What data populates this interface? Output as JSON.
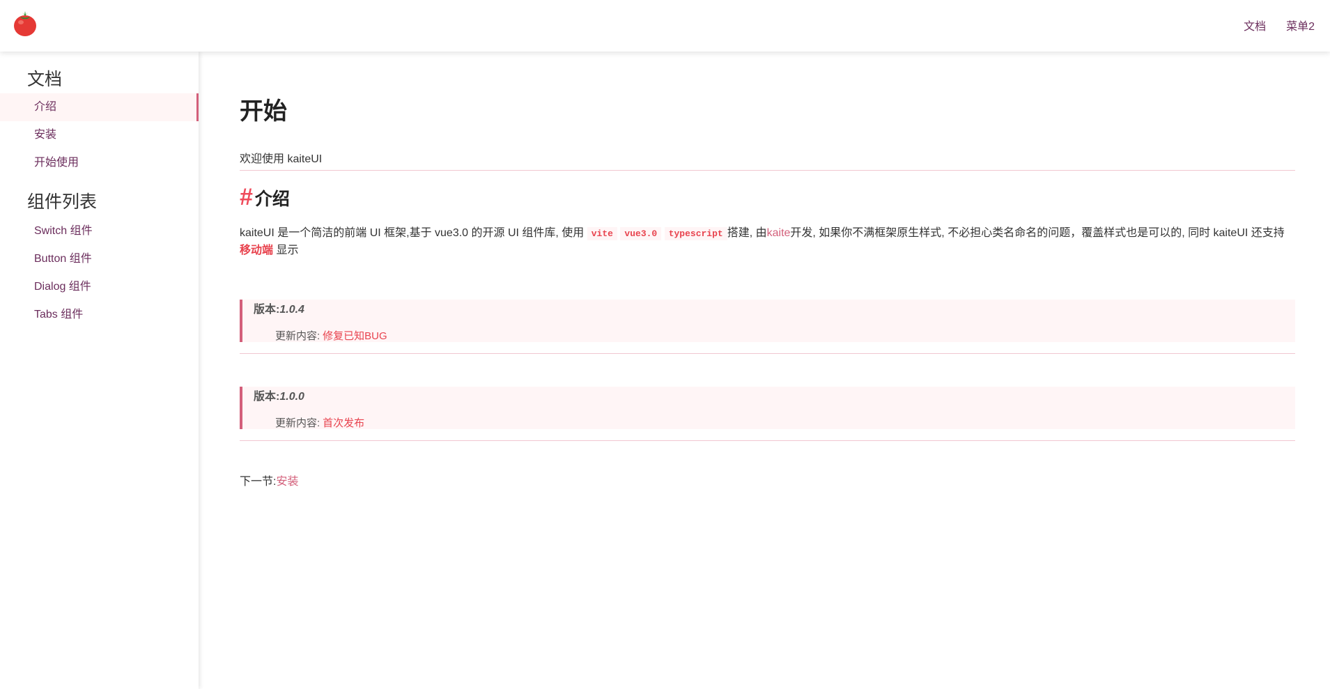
{
  "header": {
    "nav": [
      "文档",
      "菜单2"
    ]
  },
  "sidebar": {
    "groups": [
      {
        "title": "文档",
        "items": [
          "介绍",
          "安装",
          "开始使用"
        ]
      },
      {
        "title": "组件列表",
        "items": [
          "Switch 组件",
          "Button 组件",
          "Dialog 组件",
          "Tabs 组件"
        ]
      }
    ],
    "active_item": "介绍"
  },
  "main": {
    "title": "开始",
    "welcome": "欢迎使用 kaiteUI",
    "section": {
      "hash": "#",
      "title": "介绍"
    },
    "intro": {
      "p1": "kaiteUI 是一个简洁的前端 UI 框架,基于 vue3.0 的开源 UI 组件库, 使用",
      "code1": "vite",
      "code2": "vue3.0",
      "code3": "typescript",
      "p2": "搭建, 由",
      "author": "kaite",
      "p3": "开发, 如果你不满框架原生样式, 不必担心类名命名的问题，覆盖样式也是可以的, 同时 kaiteUI 还支持",
      "mobile": "移动端",
      "p4": "显示"
    },
    "versions": [
      {
        "label": "版本:",
        "number": "1.0.4",
        "update_label": "更新内容:",
        "update_value": "修复已知BUG"
      },
      {
        "label": "版本:",
        "number": "1.0.0",
        "update_label": "更新内容:",
        "update_value": "首次发布"
      }
    ],
    "next": {
      "label": "下一节:",
      "link": "安装"
    }
  },
  "colors": {
    "accent": "#d35f7a",
    "nav_text": "#6b2d5c",
    "code_red": "#e8434e"
  },
  "icons": {
    "logo": "tomato-icon"
  }
}
